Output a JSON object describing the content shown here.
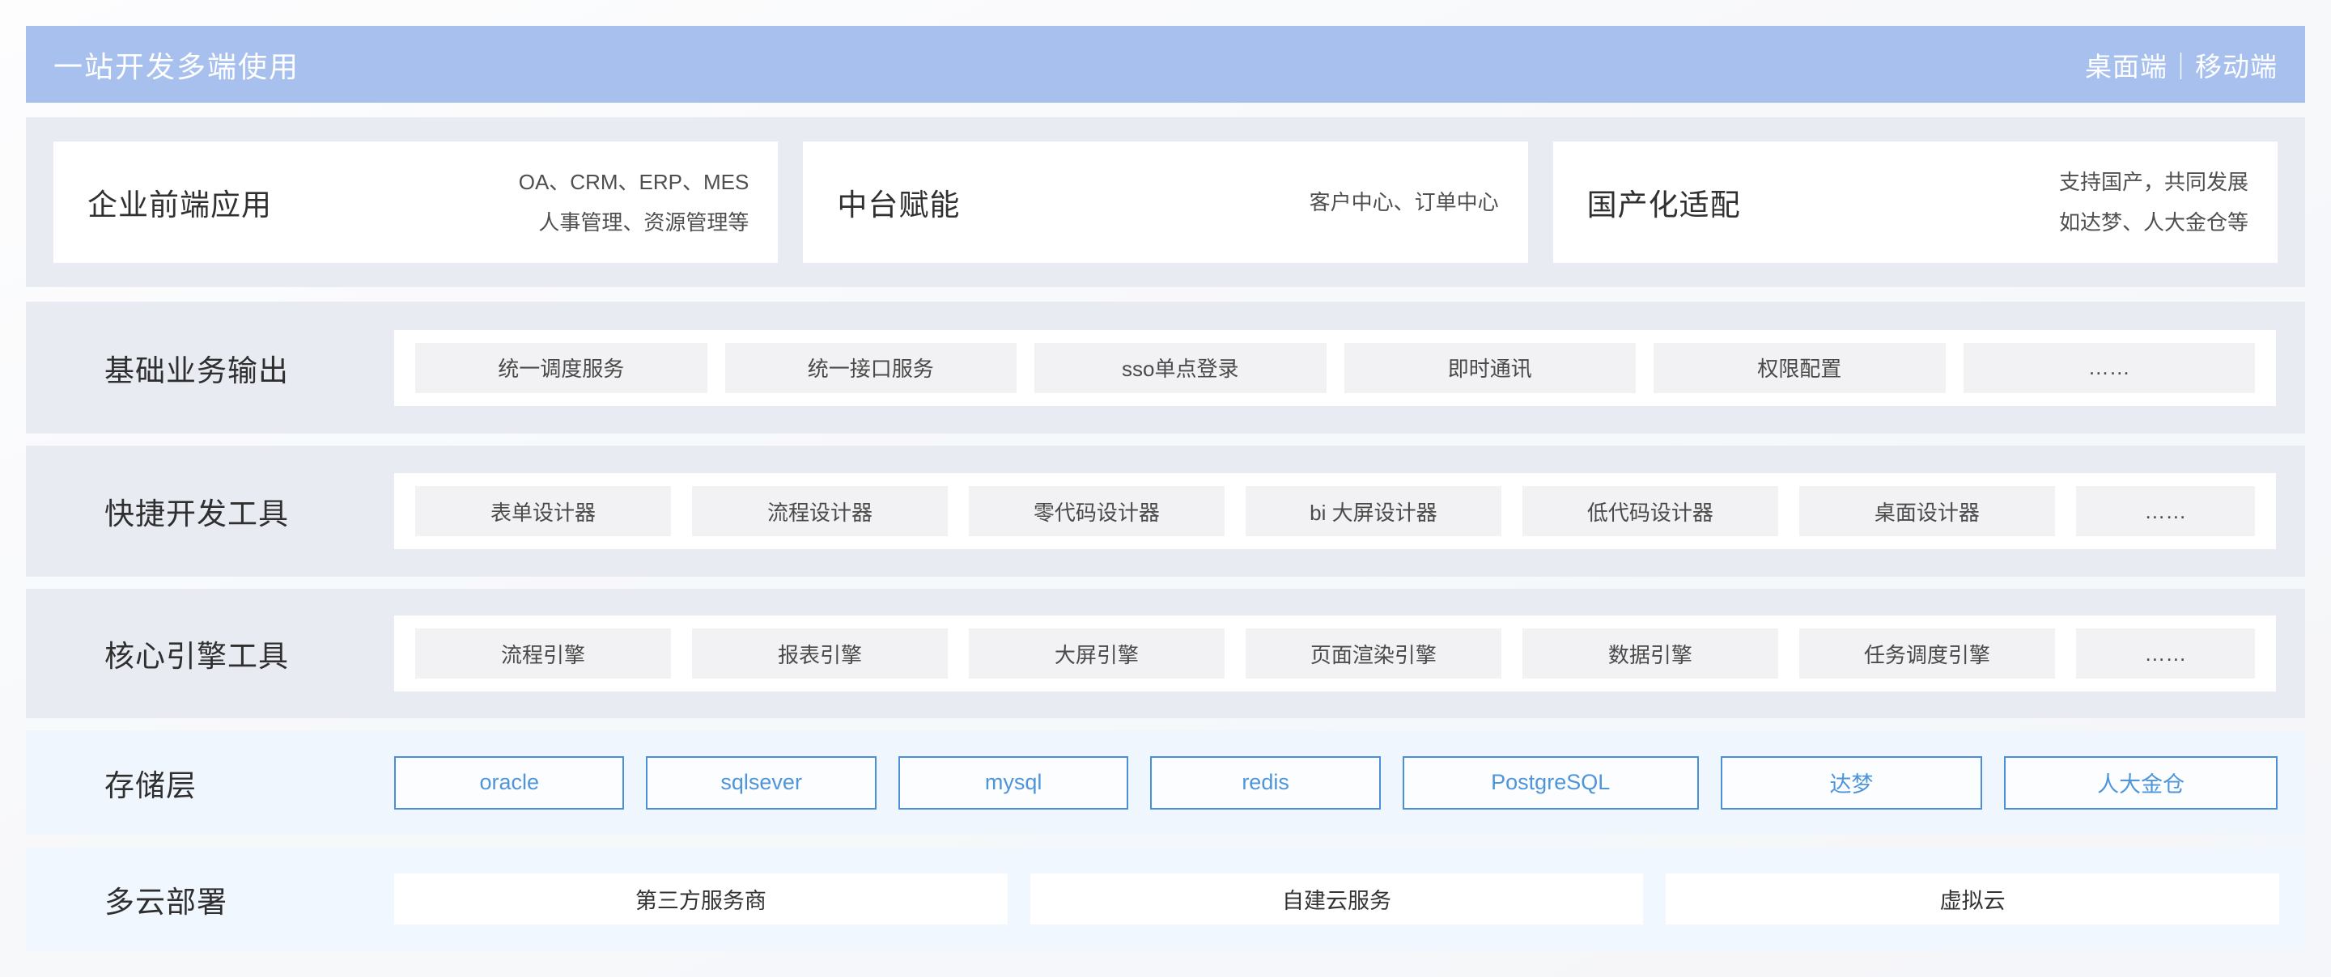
{
  "palette": {
    "banner_bg": "#a7c0ee",
    "gray_row_bg": "#e9ebf3",
    "storage_row_bg": "#f0f6fd",
    "cloud_row_bg": "#f1f7fe",
    "chip_bg": "#f2f2f4",
    "card_bg": "#ffffff",
    "accent_blue": "#4a90d8"
  },
  "header": {
    "title": "一站开发多端使用",
    "platforms": "桌面端｜移动端"
  },
  "apps": {
    "cards": [
      {
        "title": "企业前端应用",
        "desc": [
          "OA、CRM、ERP、MES",
          "人事管理、资源管理等"
        ]
      },
      {
        "title": "中台赋能",
        "desc": [
          "客户中心、订单中心"
        ]
      },
      {
        "title": "国产化适配",
        "desc": [
          "支持国产，共同发展",
          "如达梦、人大金仓等"
        ]
      }
    ]
  },
  "basic_services": {
    "label": "基础业务输出",
    "items": [
      "统一调度服务",
      "统一接口服务",
      "sso单点登录",
      "即时通讯",
      "权限配置",
      "……"
    ]
  },
  "dev_tools": {
    "label": "快捷开发工具",
    "items": [
      "表单设计器",
      "流程设计器",
      "零代码设计器",
      "bi 大屏设计器",
      "低代码设计器",
      "桌面设计器",
      "……"
    ]
  },
  "engines": {
    "label": "核心引擎工具",
    "items": [
      "流程引擎",
      "报表引擎",
      "大屏引擎",
      "页面渲染引擎",
      "数据引擎",
      "任务调度引擎",
      "……"
    ]
  },
  "storage": {
    "label": "存储层",
    "items": [
      "oracle",
      "sqlsever",
      "mysql",
      "redis",
      "PostgreSQL",
      "达梦",
      "人大金仓"
    ]
  },
  "cloud": {
    "label": "多云部署",
    "items": [
      "第三方服务商",
      "自建云服务",
      "虚拟云"
    ]
  }
}
